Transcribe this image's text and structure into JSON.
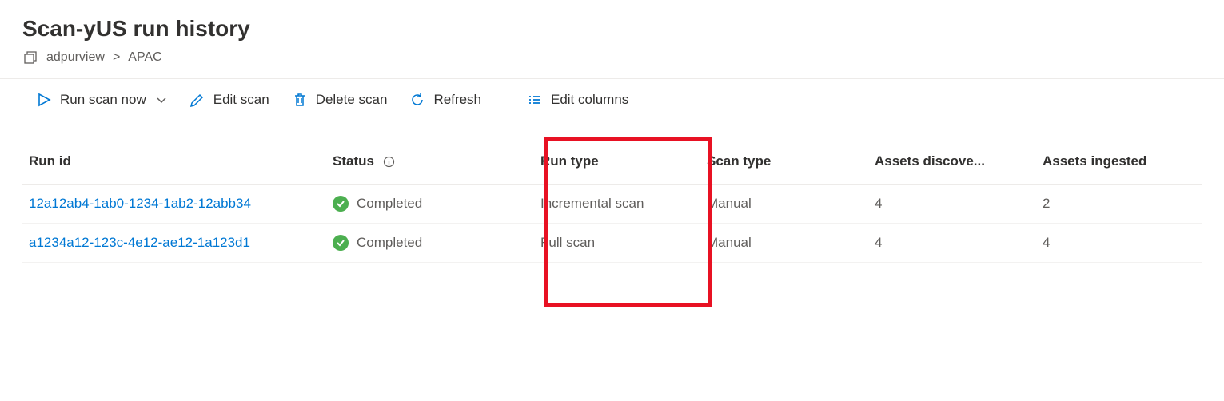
{
  "header": {
    "title": "Scan-yUS run history",
    "breadcrumb": {
      "root": "adpurview",
      "current": "APAC"
    }
  },
  "toolbar": {
    "run_scan_label": "Run scan now",
    "edit_scan_label": "Edit scan",
    "delete_scan_label": "Delete scan",
    "refresh_label": "Refresh",
    "edit_columns_label": "Edit columns"
  },
  "table": {
    "columns": {
      "run_id": "Run id",
      "status": "Status",
      "run_type": "Run type",
      "scan_type": "Scan type",
      "assets_discovered": "Assets discove...",
      "assets_ingested": "Assets ingested"
    },
    "rows": [
      {
        "run_id": "12a12ab4-1ab0-1234-1ab2-12abb34",
        "status": "Completed",
        "run_type": "Incremental scan",
        "scan_type": "Manual",
        "assets_discovered": "4",
        "assets_ingested": "2"
      },
      {
        "run_id": "a1234a12-123c-4e12-ae12-1a123d1",
        "status": "Completed",
        "run_type": "Full scan",
        "scan_type": "Manual",
        "assets_discovered": "4",
        "assets_ingested": "4"
      }
    ]
  }
}
